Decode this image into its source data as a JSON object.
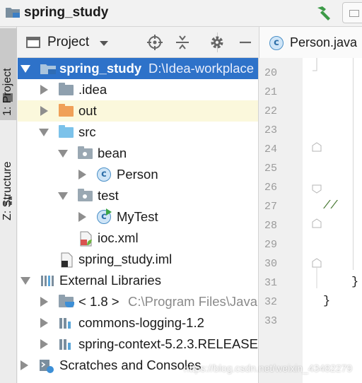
{
  "title_bar": {
    "project_name": "spring_study"
  },
  "left_stripe": {
    "project_tab": "1: Project",
    "structure_tab": "Z: Structure"
  },
  "project_toolbar": {
    "label": "Project"
  },
  "editor": {
    "tab_name": "Person.java",
    "line_numbers": [
      "20",
      "21",
      "22",
      "23",
      "24",
      "25",
      "26",
      "27",
      "28",
      "29",
      "30",
      "31",
      "32",
      "33"
    ],
    "code_comment": "//",
    "closing_brace_1": "}",
    "closing_brace_2": "}"
  },
  "tree": {
    "root": {
      "name": "spring_study",
      "path": "D:\\Idea-workplace"
    },
    "idea": ".idea",
    "out": "out",
    "src": "src",
    "bean": "bean",
    "person": "Person",
    "test": "test",
    "mytest": "MyTest",
    "iocxml": "ioc.xml",
    "iml": "spring_study.iml",
    "external_libraries": "External Libraries",
    "jdk": {
      "name": "< 1.8 >",
      "path": "C:\\Program Files\\Java"
    },
    "commons_logging": "commons-logging-1.2",
    "spring_context": "spring-context-5.2.3.RELEASE",
    "scratches": "Scratches and Consoles"
  },
  "watermark": "https://blog.csdn.net/weixin_43482279",
  "colors": {
    "selection": "#2e72c9",
    "highlight_row": "#fbf8dc",
    "folder_gray": "#8fa0ae",
    "folder_orange": "#f0a058",
    "folder_blue": "#7cc2ea"
  }
}
